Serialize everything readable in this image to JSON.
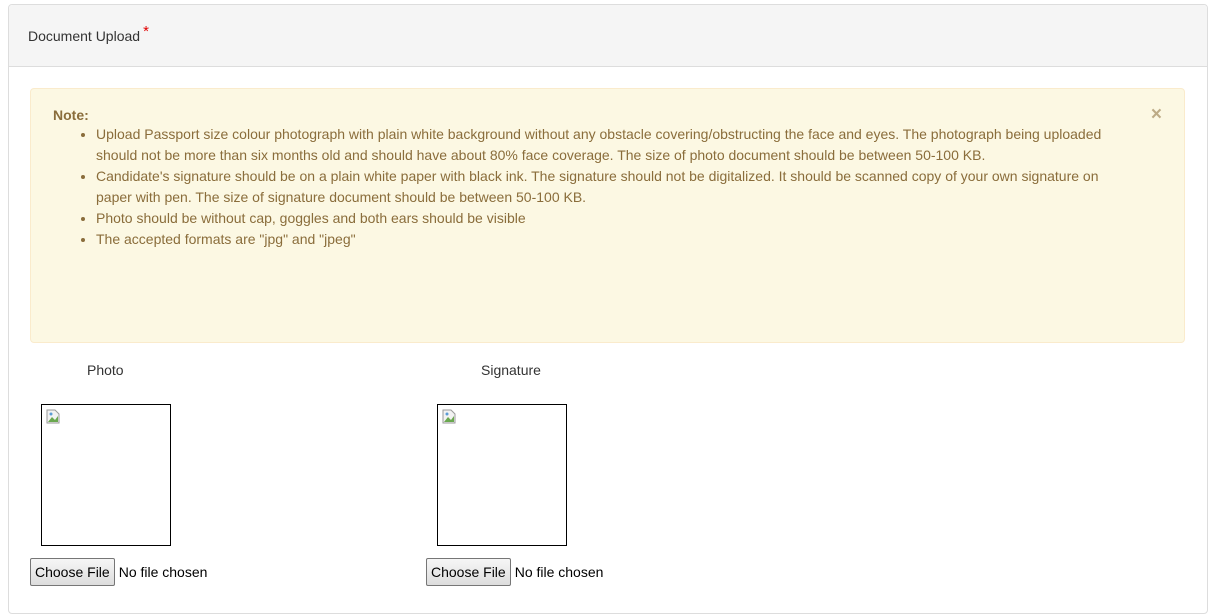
{
  "panel": {
    "title": "Document Upload",
    "required_marker": "*"
  },
  "note": {
    "title": "Note:",
    "close_glyph": "×",
    "items": [
      "Upload Passport size colour photograph with plain white background without any obstacle covering/obstructing the face and eyes. The photograph being uploaded should not be more than six months old and should have about 80% face coverage. The size of photo document should be between 50-100 KB.",
      "Candidate's signature should be on a plain white paper with black ink. The signature should not be digitalized. It should be scanned copy of your own signature on paper with pen. The size of signature document should be between 50-100 KB.",
      "Photo should be without cap, goggles and both ears should be visible",
      "The accepted formats are \"jpg\" and \"jpeg\""
    ]
  },
  "uploads": [
    {
      "label": "Photo",
      "button_label": "Choose File",
      "status": "No file chosen"
    },
    {
      "label": "Signature",
      "button_label": "Choose File",
      "status": "No file chosen"
    }
  ],
  "colors": {
    "alert_bg": "#fcf8e3",
    "alert_text": "#8a6d3b",
    "required": "#e00000"
  }
}
